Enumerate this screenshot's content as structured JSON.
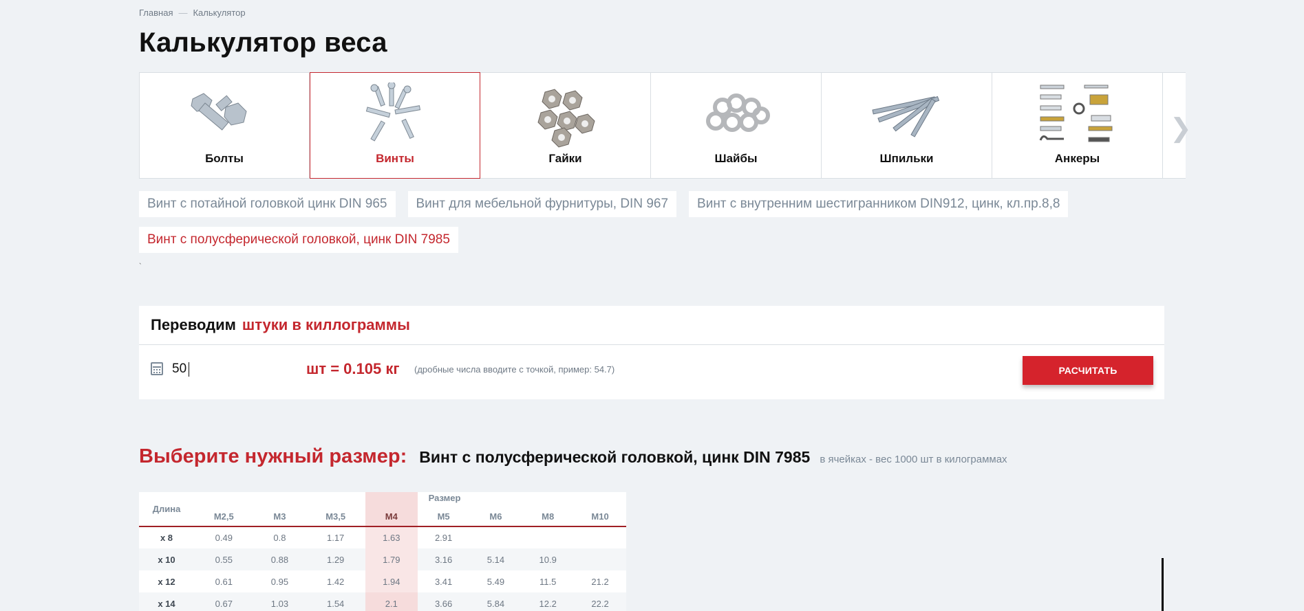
{
  "breadcrumb": {
    "home": "Главная",
    "separator": "—",
    "current": "Калькулятор"
  },
  "page_title": "Калькулятор веса",
  "categories": [
    {
      "label": "Болты",
      "icon": "bolts-image",
      "active": false
    },
    {
      "label": "Винты",
      "icon": "screws-image",
      "active": true
    },
    {
      "label": "Гайки",
      "icon": "nuts-image",
      "active": false
    },
    {
      "label": "Шайбы",
      "icon": "washers-image",
      "active": false
    },
    {
      "label": "Шпильки",
      "icon": "studs-image",
      "active": false
    },
    {
      "label": "Анкеры",
      "icon": "anchors-image",
      "active": false
    }
  ],
  "subcategories": [
    {
      "label": "Винт с потайной головкой цинк DIN 965",
      "active": false
    },
    {
      "label": "Винт для мебельной фурнитуры, DIN 967",
      "active": false
    },
    {
      "label": "Винт с внутренним шестигранником DIN912, цинк, кл.пр.8,8",
      "active": false
    },
    {
      "label": "Винт с полусферической головкой, цинк DIN 7985",
      "active": true
    }
  ],
  "stray_mark": "`",
  "calculator": {
    "title_black": "Переводим",
    "title_red": "штуки в киллограммы",
    "input_value": "50",
    "result": "шт = 0.105 кг",
    "hint": "(дробные числа вводите с точкой, пример: 54.7)",
    "button": "РАСЧИТАТЬ",
    "icon": "calculator-icon"
  },
  "size_section": {
    "heading": "Выберите нужный размер:",
    "product": "Винт с полусферической головкой, цинк DIN 7985",
    "note": "в ячейках - вес 1000 шт в килограммах"
  },
  "table": {
    "group_header": "Размер",
    "length_header": "Длина",
    "columns": [
      "M2,5",
      "M3",
      "M3,5",
      "M4",
      "M5",
      "M6",
      "M8",
      "M10"
    ],
    "selected_column": "M4",
    "rows": [
      {
        "label": "x 8",
        "values": [
          "0.49",
          "0.8",
          "1.17",
          "1.63",
          "2.91",
          "",
          "",
          ""
        ]
      },
      {
        "label": "x 10",
        "values": [
          "0.55",
          "0.88",
          "1.29",
          "1.79",
          "3.16",
          "5.14",
          "10.9",
          ""
        ]
      },
      {
        "label": "x 12",
        "values": [
          "0.61",
          "0.95",
          "1.42",
          "1.94",
          "3.41",
          "5.49",
          "11.5",
          "21.2"
        ]
      },
      {
        "label": "x 14",
        "values": [
          "0.67",
          "1.03",
          "1.54",
          "2.1",
          "3.66",
          "5.84",
          "12.2",
          "22.2"
        ]
      }
    ]
  },
  "colors": {
    "accent": "#c4272e",
    "button": "#d5232c",
    "background": "#eff2f5",
    "muted": "#7a8896"
  }
}
